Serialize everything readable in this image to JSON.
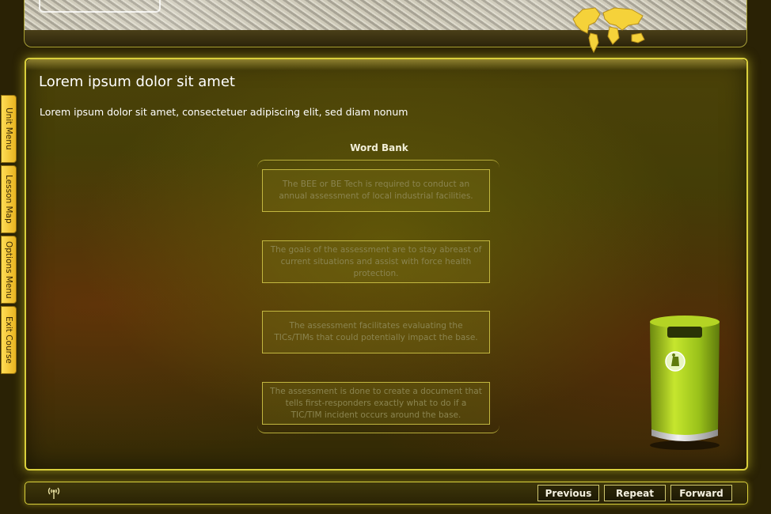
{
  "header": {
    "logo_icon": "logo-outline",
    "map_icon": "world-map-icon"
  },
  "content": {
    "title": "Lorem ipsum dolor sit amet",
    "subtitle": "Lorem ipsum dolor sit amet, consectetuer adipiscing elit, sed diam nonum"
  },
  "word_bank": {
    "title": "Word Bank",
    "cards": [
      "The BEE or BE Tech is required to conduct an annual assessment of local industrial facilities.",
      "The goals of the assessment are to stay abreast of current situations and assist with force health protection.",
      "The assessment facilitates evaluating the TICs/TIMs that could potentially impact the base.",
      "The assessment is done to create a document that tells first-responders exactly what to do if a TIC/TIM incident occurs around the base."
    ]
  },
  "side_tabs": [
    "Unit Menu",
    "Lesson Map",
    "Options Menu",
    "Exit Course"
  ],
  "footer": {
    "buttons": {
      "previous": "Previous",
      "repeat": "Repeat",
      "forward": "Forward"
    },
    "icon": "broadcast-icon"
  },
  "colors": {
    "accent": "#d9cf3c",
    "tab": "#f1c232",
    "trash_body": "#9ac21a"
  }
}
